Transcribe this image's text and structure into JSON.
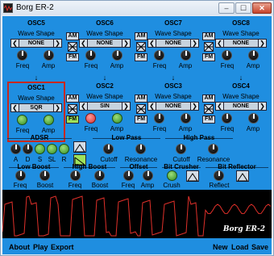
{
  "window": {
    "title": "Borg ER-2",
    "min_glyph": "–",
    "max_glyph": "☐",
    "close_glyph": "✕"
  },
  "common": {
    "wave_shape": "Wave Shape",
    "freq": "Freq",
    "amp": "Amp",
    "am": "AM",
    "fm": "FM",
    "left_arrow": "❮",
    "right_arrow": "❯"
  },
  "oscillators": [
    {
      "name": "OSC5",
      "value": "NONE",
      "active": false
    },
    {
      "name": "OSC6",
      "value": "NONE",
      "active": false
    },
    {
      "name": "OSC7",
      "value": "NONE",
      "active": false
    },
    {
      "name": "OSC8",
      "value": "NONE",
      "active": false
    },
    {
      "name": "OSC1",
      "value": "SQR",
      "active": true
    },
    {
      "name": "OSC2",
      "value": "SIN",
      "active": false
    },
    {
      "name": "OSC3",
      "value": "NONE",
      "active": false
    },
    {
      "name": "OSC4",
      "value": "NONE",
      "active": false
    }
  ],
  "adsr": {
    "title": "ADSR",
    "labels": [
      "A",
      "D",
      "S",
      "SL",
      "R"
    ]
  },
  "low_pass": {
    "title": "Low Pass",
    "cutoff": "Cutoff",
    "resonance": "Resonance"
  },
  "high_pass": {
    "title": "High Pass",
    "cutoff": "Cutoff",
    "resonance": "Resonance"
  },
  "low_boost": {
    "title": "Low Boost",
    "freq": "Freq",
    "boost": "Boost"
  },
  "high_boost": {
    "title": "High Boost",
    "freq": "Freq",
    "boost": "Boost"
  },
  "offset": {
    "title": "Offset",
    "freq": "Freq",
    "amp": "Amp"
  },
  "bit_crusher": {
    "title": "Bit Crusher",
    "crush": "Crush"
  },
  "bit_reflector": {
    "title": "Bit Reflector",
    "reflect": "Reflect"
  },
  "scope": {
    "label": "Borg ER-2",
    "trace_color": "#e0302a"
  },
  "menu": {
    "about": "About",
    "play": "Play",
    "export": "Export",
    "new": "New",
    "load": "Load",
    "save": "Save"
  },
  "colors": {
    "panel": "#1f8ee0",
    "active_border": "#c8281c",
    "button_on": "#9ee25b"
  }
}
